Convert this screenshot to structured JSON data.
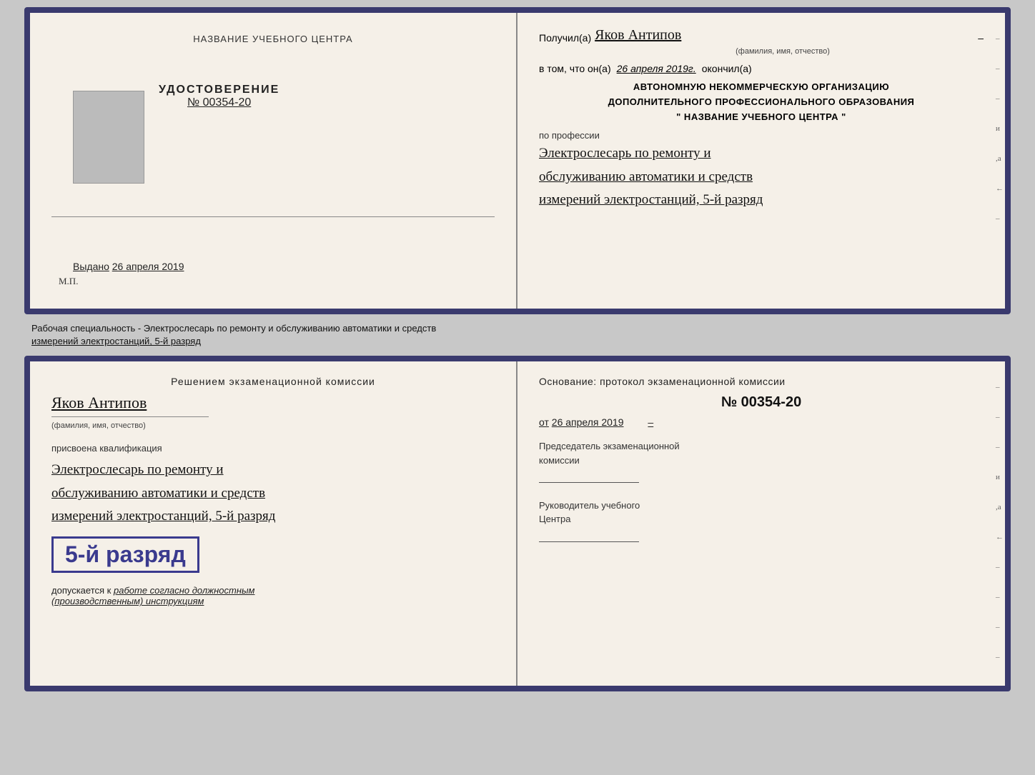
{
  "top_doc": {
    "left": {
      "school_name": "НАЗВАНИЕ УЧЕБНОГО ЦЕНТРА",
      "cert_label": "УДОСТОВЕРЕНИЕ",
      "cert_number": "№ 00354-20",
      "issued_label": "Выдано",
      "issued_date": "26 апреля 2019",
      "mp_label": "М.П."
    },
    "right": {
      "received_prefix": "Получил(а)",
      "received_name": "Яков Антипов",
      "fio_hint": "(фамилия, имя, отчество)",
      "confirms_prefix": "в том, что он(а)",
      "confirms_date": "26 апреля 2019г.",
      "confirms_suffix": "окончил(а)",
      "org_line1": "АВТОНОМНУЮ НЕКОММЕРЧЕСКУЮ ОРГАНИЗАЦИЮ",
      "org_line2": "ДОПОЛНИТЕЛЬНОГО ПРОФЕССИОНАЛЬНОГО ОБРАЗОВАНИЯ",
      "org_line3": "\"  НАЗВАНИЕ УЧЕБНОГО ЦЕНТРА  \"",
      "profession_label": "по профессии",
      "profession_line1": "Электрослесарь по ремонту и",
      "profession_line2": "обслуживанию автоматики и средств",
      "profession_line3": "измерений электростанций, 5-й разряд"
    }
  },
  "separator": {
    "text": "Рабочая специальность - Электрослесарь по ремонту и обслуживанию автоматики и средств",
    "text2": "измерений электростанций, 5-й разряд"
  },
  "bottom_doc": {
    "left": {
      "decision_text": "Решением  экзаменационной  комиссии",
      "person_name": "Яков Антипов",
      "fio_hint": "(фамилия, имя, отчество)",
      "assigned_label": "присвоена квалификация",
      "qual_line1": "Электрослесарь по ремонту и",
      "qual_line2": "обслуживанию автоматики и средств",
      "qual_line3": "измерений электростанций, 5-й разряд",
      "grade_badge": "5-й разряд",
      "allowed_prefix": "допускается к",
      "allowed_italic": "работе согласно должностным",
      "allowed_italic2": "(производственным) инструкциям"
    },
    "right": {
      "basis_label": "Основание: протокол экзаменационной  комиссии",
      "protocol_number": "№  00354-20",
      "protocol_date_prefix": "от",
      "protocol_date": "26 апреля 2019",
      "chairman_label": "Председатель экзаменационной",
      "chairman_label2": "комиссии",
      "director_label": "Руководитель учебного",
      "director_label2": "Центра"
    }
  },
  "marks": {
    "right_chars": [
      "–",
      "–",
      "–",
      "и",
      ",а",
      "←",
      "–",
      "–",
      "–",
      "–"
    ]
  }
}
